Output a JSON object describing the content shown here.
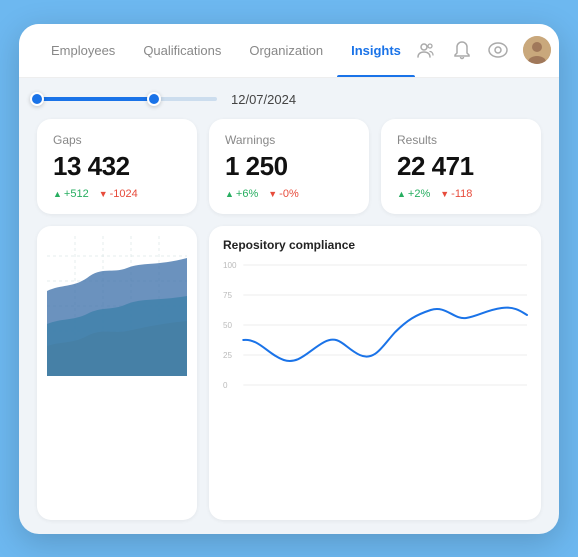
{
  "nav": {
    "tabs": [
      {
        "id": "employees",
        "label": "Employees",
        "active": false
      },
      {
        "id": "qualifications",
        "label": "Qualifications",
        "active": false
      },
      {
        "id": "organization",
        "label": "Organization",
        "active": false
      },
      {
        "id": "insights",
        "label": "Insights",
        "active": true
      }
    ]
  },
  "header": {
    "date": "12/07/2024"
  },
  "stats": [
    {
      "id": "gaps",
      "title": "Gaps",
      "value": "13 432",
      "change_up": "+512",
      "change_down": "-1024"
    },
    {
      "id": "warnings",
      "title": "Warnings",
      "value": "1 250",
      "change_up": "+6%",
      "change_down": "-0%"
    },
    {
      "id": "results",
      "title": "Results",
      "value": "22 471",
      "change_up": "+2%",
      "change_down": "-118"
    }
  ],
  "repo_chart": {
    "title": "Repository compliance",
    "y_labels": [
      "100",
      "75",
      "50",
      "25",
      "0"
    ]
  },
  "colors": {
    "accent": "#1a73e8",
    "up": "#27ae60",
    "down": "#e74c3c",
    "area1": "#3a6ea8",
    "area2": "#4fb8b0",
    "area3": "#e8a84a"
  }
}
